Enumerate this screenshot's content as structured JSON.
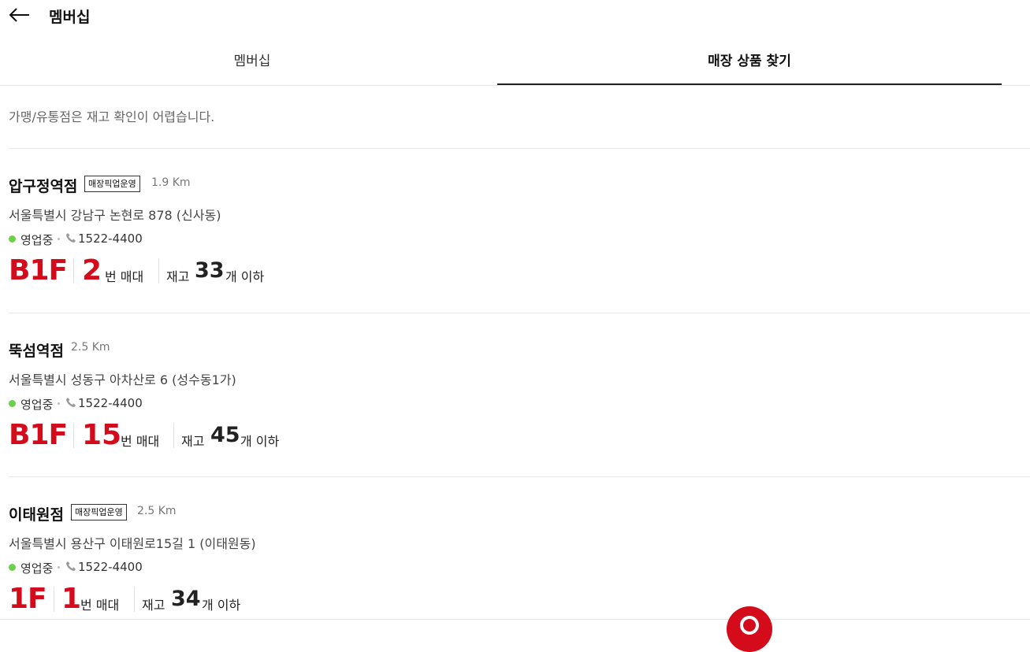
{
  "header": {
    "title": "멤버십"
  },
  "tabs": [
    {
      "label": "멤버십",
      "active": false
    },
    {
      "label": "매장 상품 찾기",
      "active": true
    }
  ],
  "notice": "가맹/유통점은 재고 확인이 어렵습니다.",
  "stores": [
    {
      "name": "압구정역점",
      "badge": "매장픽업운영",
      "distance": "1.9 Km",
      "address": "서울특별시 강남구 논현로 878 (신사동)",
      "status": "영업중",
      "phone": "1522-4400",
      "floor": "B1F",
      "stand_number": "2",
      "stand_label": "번 매대",
      "stock_label": "재고",
      "stock_count": "33",
      "stock_suffix": "개 이하"
    },
    {
      "name": "뚝섬역점",
      "badge": "",
      "distance": "2.5 Km",
      "address": "서울특별시 성동구 아차산로 6 (성수동1가)",
      "status": "영업중",
      "phone": "1522-4400",
      "floor": "B1F",
      "stand_number": "15",
      "stand_label": "번 매대",
      "stock_label": "재고",
      "stock_count": "45",
      "stock_suffix": "개 이하"
    },
    {
      "name": "이태원점",
      "badge": "매장픽업운영",
      "distance": "2.5 Km",
      "address": "서울특별시 용산구 이태원로15길 1 (이태원동)",
      "status": "영업중",
      "phone": "1522-4400",
      "floor": "1F",
      "stand_number": "1",
      "stand_label": "번 매대",
      "stock_label": "재고",
      "stock_count": "34",
      "stock_suffix": "개 이하"
    }
  ],
  "colors": {
    "accent_red": "#d40b1a",
    "open_green": "#6bd14a"
  },
  "icons": [
    "back-arrow-icon",
    "phone-icon",
    "status-dot-icon"
  ]
}
